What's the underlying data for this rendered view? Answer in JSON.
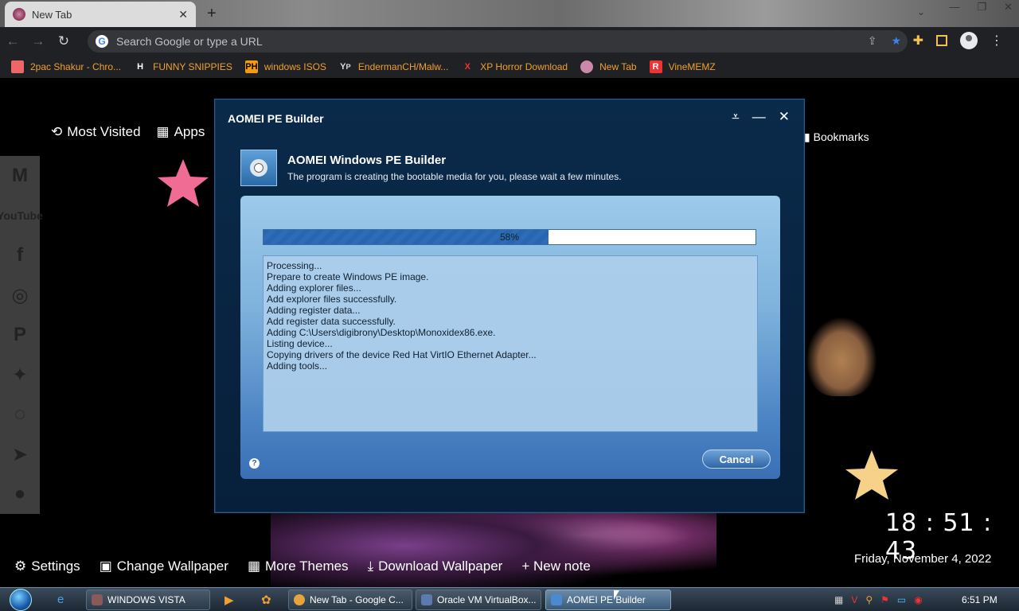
{
  "browser": {
    "tab_title": "New Tab",
    "omnibox_placeholder": "Search Google or type a URL",
    "bookmarks": [
      {
        "label": "2pac Shakur - Chro...",
        "icon": "folder-icon",
        "color": "#e66"
      },
      {
        "label": "FUNNY SNIPPIES",
        "icon": "H",
        "color": "#fff"
      },
      {
        "label": "windows ISOS",
        "icon": "PH",
        "color": "#f39c12"
      },
      {
        "label": "EndermanCH/Malw...",
        "icon": "YP",
        "color": "#ddd"
      },
      {
        "label": "XP Horror Download",
        "icon": "X",
        "color": "#e33"
      },
      {
        "label": "New Tab",
        "icon": "avatar-icon",
        "color": "#c8a"
      },
      {
        "label": "VineMEMZ",
        "icon": "R",
        "color": "#e33"
      }
    ]
  },
  "newtab": {
    "most_visited": "Most Visited",
    "apps": "Apps",
    "bookmarks": "Bookmarks",
    "clock": "18 : 51 : 43",
    "date": "Friday, November 4, 2022",
    "bottom": {
      "settings": "Settings",
      "change_wallpaper": "Change Wallpaper",
      "more_themes": "More Themes",
      "download_wallpaper": "Download Wallpaper",
      "new_note": "+ New note"
    },
    "social": [
      "gmail-icon",
      "youtube-icon",
      "facebook-icon",
      "instagram-icon",
      "pinterest-icon",
      "twitter-icon",
      "whatsapp-icon",
      "telegram-icon",
      "reddit-icon"
    ],
    "youtube_text": "YouTube"
  },
  "dialog": {
    "title": "AOMEI PE Builder",
    "heading": "AOMEI Windows PE Builder",
    "subtitle": "The program is creating the bootable media for you, please wait a few minutes.",
    "progress_percent": 58,
    "progress_label": "58%",
    "log_lines": [
      "Processing...",
      "Prepare to create Windows PE image.",
      "Adding explorer files...",
      "Add explorer files successfully.",
      "Adding register data...",
      "Add register data successfully.",
      "Adding C:\\Users\\digibrony\\Desktop\\Monoxidex86.exe.",
      "Listing device...",
      "Copying drivers of the device Red Hat VirtIO Ethernet Adapter...",
      "Adding tools..."
    ],
    "cancel_label": "Cancel"
  },
  "taskbar": {
    "buttons": [
      {
        "label": "WINDOWS VISTA",
        "color": "#8a5a5a"
      },
      {
        "label": "New Tab - Google C...",
        "color": "#e8a33c"
      },
      {
        "label": "Oracle VM VirtualBox...",
        "color": "#5a7ab0"
      },
      {
        "label": "AOMEI PE Builder",
        "color": "#4a8ad0"
      }
    ],
    "time": "6:51 PM"
  }
}
